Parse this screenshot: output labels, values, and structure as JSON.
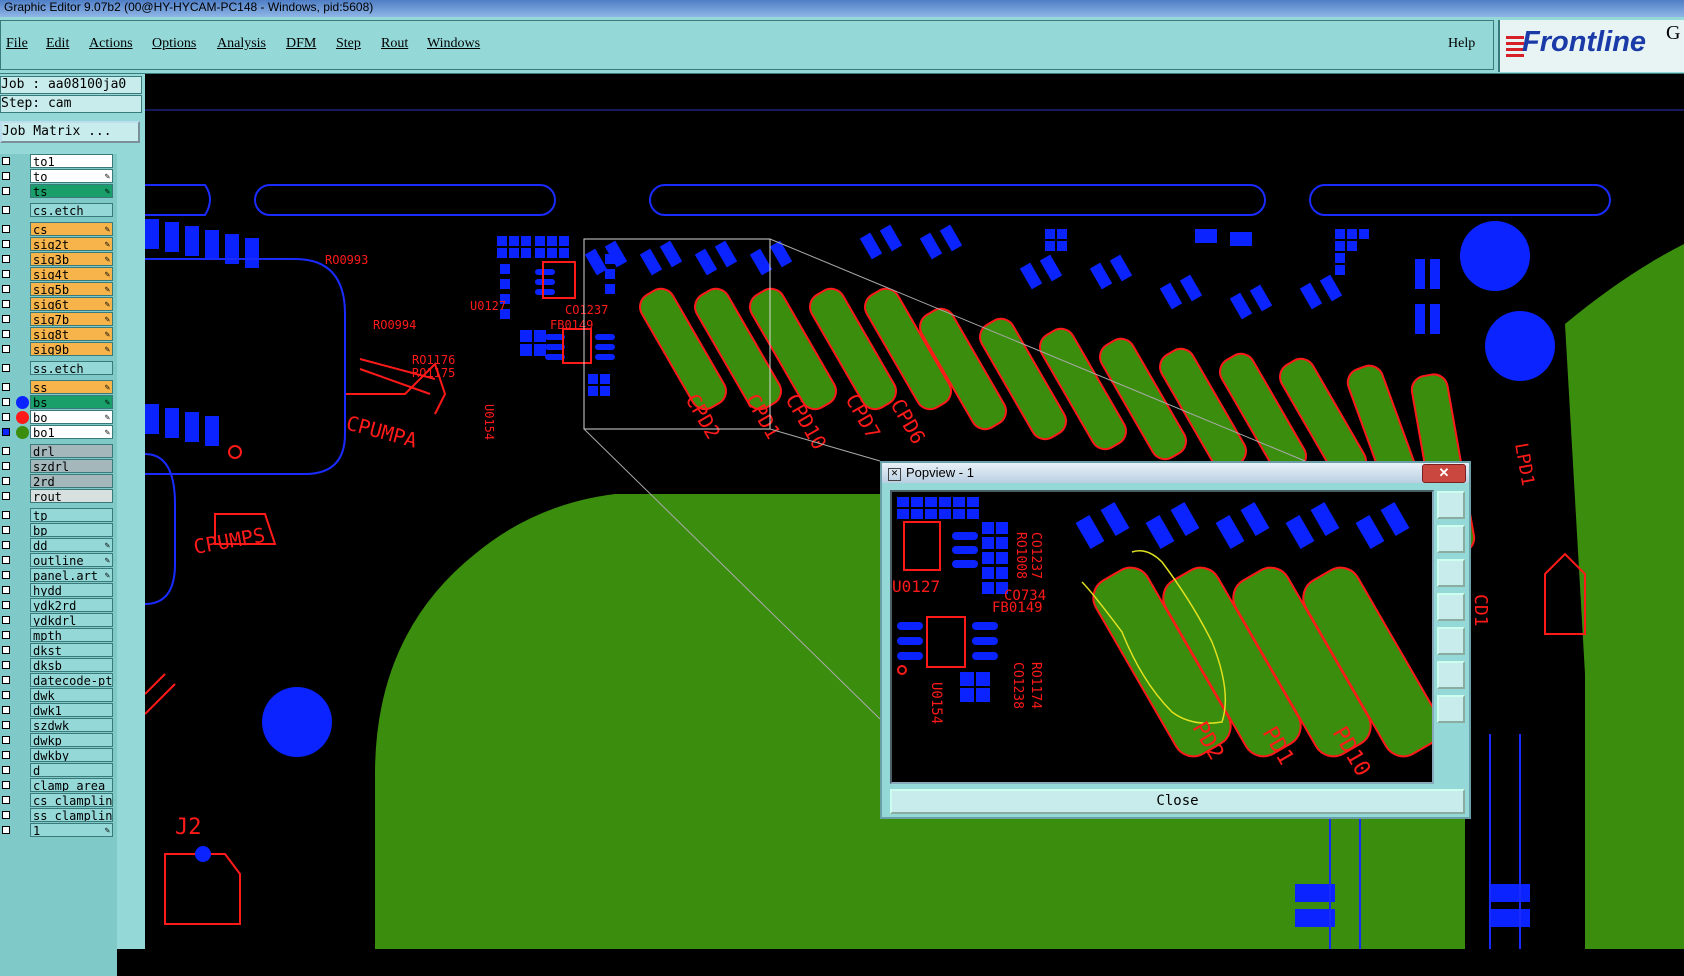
{
  "window": {
    "title": "Graphic Editor 9.07b2 (00@HY-HYCAM-PC148 - Windows, pid:5608)"
  },
  "menu": {
    "items": [
      "File",
      "Edit",
      "Actions",
      "Options",
      "Analysis",
      "DFM",
      "Step",
      "Rout",
      "Windows"
    ],
    "help": "Help"
  },
  "logo": {
    "text": "Frontline",
    "trailing": "G"
  },
  "job": {
    "job_line": "Job : aa08100ja0",
    "step_line": "Step: cam",
    "matrix_button": "Job Matrix ..."
  },
  "colors": {
    "panel_bg": "#95d8d8",
    "copper_top": "#2a8a28",
    "board_fill": "#3b8d0d",
    "pads": "#0a23ff",
    "silk": "#ff1a1a",
    "highlight_orange": "#f7b44a",
    "highlight_green": "#1a9f6a",
    "layer_grey": "#a4b8bc"
  },
  "layers": [
    {
      "name": "to1",
      "style": "white"
    },
    {
      "name": "to",
      "style": "white",
      "pen": true
    },
    {
      "name": "ts",
      "style": "green",
      "pen": true
    },
    {
      "name": "cs.etch",
      "style": "plain"
    },
    {
      "name": "cs",
      "style": "orange",
      "pen": true
    },
    {
      "name": "sig2t",
      "style": "orange",
      "pen": true
    },
    {
      "name": "sig3b",
      "style": "orange",
      "pen": true
    },
    {
      "name": "sig4t",
      "style": "orange",
      "pen": true
    },
    {
      "name": "sig5b",
      "style": "orange",
      "pen": true
    },
    {
      "name": "sig6t",
      "style": "orange",
      "pen": true
    },
    {
      "name": "sig7b",
      "style": "orange",
      "pen": true
    },
    {
      "name": "sig8t",
      "style": "orange",
      "pen": true
    },
    {
      "name": "sig9b",
      "style": "orange",
      "pen": true
    },
    {
      "name": "ss.etch",
      "style": "plain"
    },
    {
      "name": "ss",
      "style": "orange",
      "pen": true
    },
    {
      "name": "bs",
      "style": "green",
      "pen": true,
      "dot": "blue"
    },
    {
      "name": "bo",
      "style": "white",
      "pen": true,
      "dot": "red"
    },
    {
      "name": "bo1",
      "style": "white",
      "pen": true,
      "dot": "green",
      "checked": true
    },
    {
      "name": "drl",
      "style": "grey"
    },
    {
      "name": "szdrl",
      "style": "grey"
    },
    {
      "name": "2rd",
      "style": "grey"
    },
    {
      "name": "rout",
      "style": "lightgrey"
    },
    {
      "name": "tp",
      "style": "plain"
    },
    {
      "name": "bp",
      "style": "plain"
    },
    {
      "name": "dd",
      "style": "plain",
      "pen": true
    },
    {
      "name": "outline",
      "style": "plain",
      "pen": true
    },
    {
      "name": "panel.art",
      "style": "plain",
      "pen": true
    },
    {
      "name": "hydd",
      "style": "plain"
    },
    {
      "name": "ydk2rd",
      "style": "plain"
    },
    {
      "name": "ydkdrl",
      "style": "plain"
    },
    {
      "name": "mpth",
      "style": "plain"
    },
    {
      "name": "dkst",
      "style": "plain"
    },
    {
      "name": "dksb",
      "style": "plain"
    },
    {
      "name": "datecode-pte",
      "style": "plain"
    },
    {
      "name": "dwk",
      "style": "plain"
    },
    {
      "name": "dwk1",
      "style": "plain"
    },
    {
      "name": "szdwk",
      "style": "plain"
    },
    {
      "name": "dwkp",
      "style": "plain"
    },
    {
      "name": "dwkby",
      "style": "plain"
    },
    {
      "name": "d",
      "style": "plain"
    },
    {
      "name": "clamp_area",
      "style": "plain"
    },
    {
      "name": "cs_clampline",
      "style": "plain"
    },
    {
      "name": "ss_clampline",
      "style": "plain"
    },
    {
      "name": "1",
      "style": "plain",
      "pen": true
    }
  ],
  "board_labels": {
    "cpumpa": "CPUMPA",
    "cpumps": "CPUMPS",
    "u0127": "U0127",
    "u0154": "U0154",
    "cpd2": "CPD2",
    "cpd1": "CPD1",
    "cpd10": "CPD10",
    "cpd7": "CPD7",
    "cpd6": "CPD6",
    "ro0993": "RO0993",
    "ro0994": "RO0994",
    "ro1176": "RO1176",
    "ro1175": "RO1175",
    "co1237": "CO1237",
    "fb0149": "FB0149",
    "cd1": "CD1",
    "lpd1": "LPD1",
    "j2": "J2"
  },
  "popview": {
    "title": "Popview - 1",
    "close_x": "✕",
    "close_label": "Close",
    "labels": [
      "U0127",
      "U0154",
      "RO1008",
      "CO1237",
      "FB0149",
      "CO734",
      "RO1174",
      "CO1238",
      "PD2",
      "PD1",
      "PD10"
    ]
  }
}
